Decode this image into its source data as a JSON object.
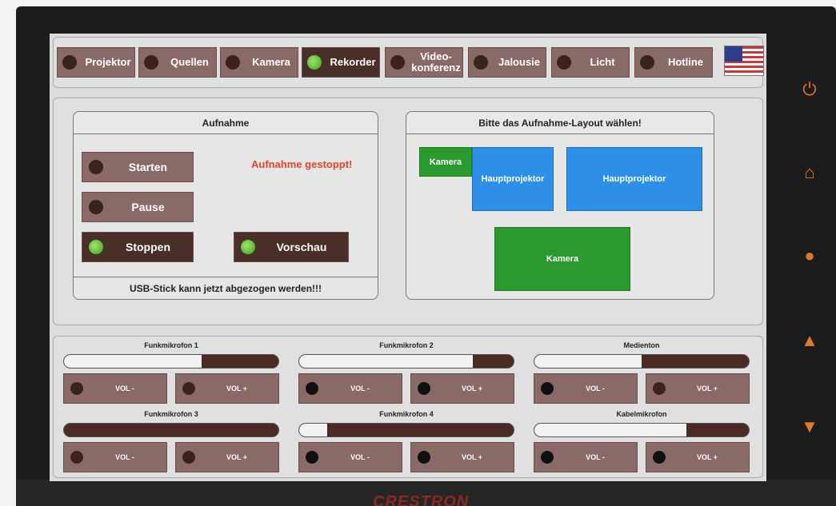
{
  "nav": {
    "items": [
      {
        "label": "Projektor",
        "active": false
      },
      {
        "label": "Quellen",
        "active": false
      },
      {
        "label": "Kamera",
        "active": false
      },
      {
        "label": "Rekorder",
        "active": true
      },
      {
        "label": "Video-\nkonferenz",
        "active": false
      },
      {
        "label": "Jalousie",
        "active": false
      },
      {
        "label": "Licht",
        "active": false
      },
      {
        "label": "Hotline",
        "active": false
      }
    ],
    "flag_icon": "us-flag-icon"
  },
  "recording": {
    "header": "Aufnahme",
    "start_label": "Starten",
    "pause_label": "Pause",
    "stop_label": "Stoppen",
    "preview_label": "Vorschau",
    "status": "Aufnahme gestoppt!",
    "footer": "USB-Stick kann jetzt abgezogen werden!!!"
  },
  "layout": {
    "header": "Bitte das Aufnahme-Layout wählen!",
    "option1_camera": "Kamera",
    "option1_projector": "Hauptprojektor",
    "option2_projector": "Hauptprojektor",
    "option3_camera": "Kamera"
  },
  "audio": {
    "vol_minus": "VOL -",
    "vol_plus": "VOL +",
    "channels": [
      {
        "name": "Funkmikrofon 1",
        "level": 0.64
      },
      {
        "name": "Funkmikrofon 2",
        "level": 0.81
      },
      {
        "name": "Medienton",
        "level": 0.5
      },
      {
        "name": "Funkmikrofon 3",
        "level": 0.0
      },
      {
        "name": "Funkmikrofon 4",
        "level": 0.13
      },
      {
        "name": "Kabelmikrofon",
        "level": 0.71
      }
    ]
  },
  "device": {
    "brand": "CRESTRON"
  },
  "colors": {
    "button": "#8a6a66",
    "button_active": "#4a2e28",
    "lamp_on": "#5cc030",
    "status_text": "#e0452a",
    "layout_blue": "#2e8fe8",
    "layout_green": "#2a9a2e",
    "side_icons": "#e0782a"
  }
}
